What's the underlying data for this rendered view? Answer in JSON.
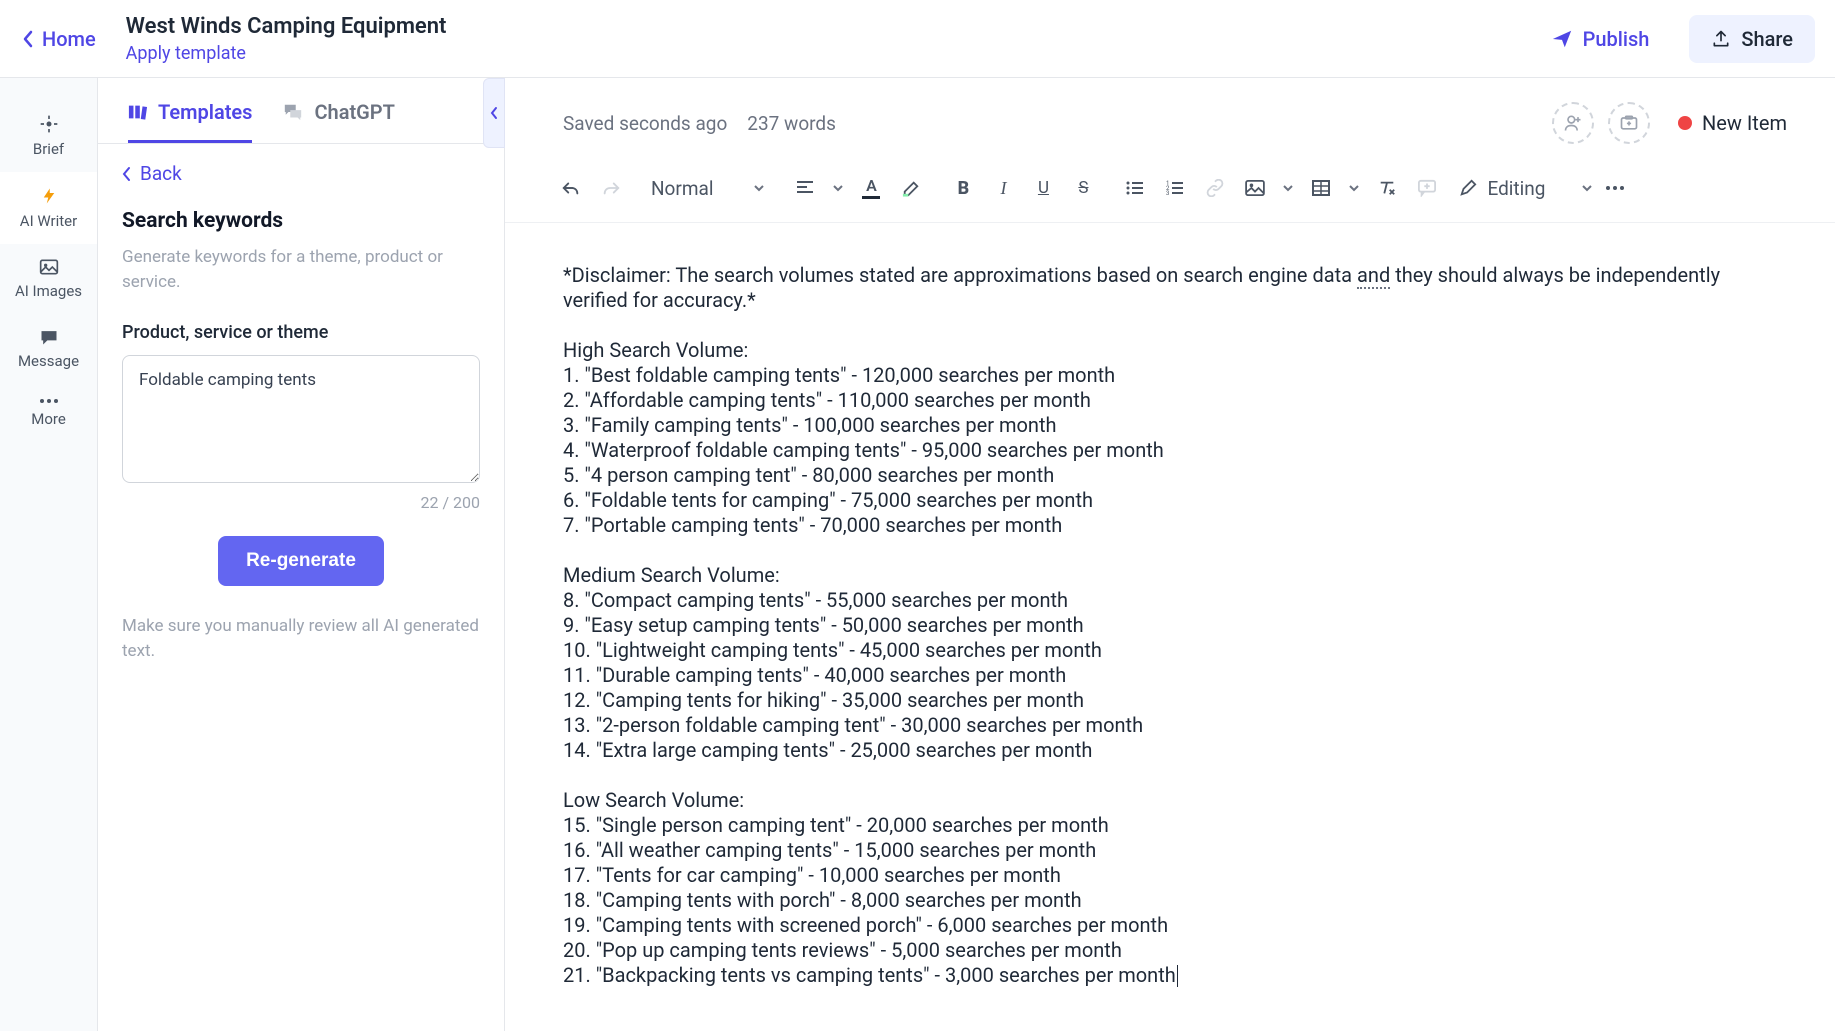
{
  "header": {
    "home": "Home",
    "title": "West Winds Camping Equipment",
    "apply_template": "Apply template",
    "publish": "Publish",
    "share": "Share"
  },
  "rail": {
    "brief": "Brief",
    "ai_writer": "AI Writer",
    "ai_images": "AI Images",
    "message": "Message",
    "more": "More"
  },
  "sidepanel": {
    "tabs": {
      "templates": "Templates",
      "chatgpt": "ChatGPT"
    },
    "back": "Back",
    "heading": "Search keywords",
    "desc": "Generate keywords for a theme, product or service.",
    "field_label": "Product, service or theme",
    "input_value": "Foldable camping tents",
    "char_count": "22 / 200",
    "regen": "Re-generate",
    "review_note": "Make sure you manually review all AI generated text."
  },
  "editor": {
    "saved": "Saved seconds ago",
    "word_count": "237 words",
    "new_item": "New Item",
    "style_select": "Normal",
    "mode_select": "Editing"
  },
  "doc": {
    "disclaimer_pre": "*Disclaimer: The search volumes stated are approximations based on search engine data ",
    "disclaimer_and": "and",
    "disclaimer_post": " they should always be independently verified for accuracy.*",
    "sections": [
      {
        "title": "High Search Volume:",
        "items": [
          "1. \"Best foldable camping tents\" - 120,000 searches per month",
          "2. \"Affordable camping tents\" - 110,000 searches per month",
          "3. \"Family camping tents\" - 100,000 searches per month",
          "4. \"Waterproof foldable camping tents\" - 95,000 searches per month",
          "5. \"4 person camping tent\" - 80,000 searches per month",
          "6. \"Foldable tents for camping\" - 75,000 searches per month",
          "7. \"Portable camping tents\" - 70,000 searches per month"
        ]
      },
      {
        "title": "Medium Search Volume:",
        "items": [
          "8. \"Compact camping tents\" - 55,000 searches per month",
          "9. \"Easy setup camping tents\" - 50,000 searches per month",
          "10. \"Lightweight camping tents\" - 45,000 searches per month",
          "11. \"Durable camping tents\" - 40,000 searches per month",
          "12. \"Camping tents for hiking\" - 35,000 searches per month",
          "13. \"2-person foldable camping tent\" - 30,000 searches per month",
          "14. \"Extra large camping tents\" - 25,000 searches per month"
        ]
      },
      {
        "title": "Low Search Volume:",
        "items": [
          "15. \"Single person camping tent\" - 20,000 searches per month",
          "16. \"All weather camping tents\" - 15,000 searches per month",
          "17. \"Tents for car camping\" - 10,000 searches per month",
          "18. \"Camping tents with porch\" - 8,000 searches per month",
          "19. \"Camping tents with screened porch\" - 6,000 searches per month",
          "20. \"Pop up camping tents reviews\" - 5,000 searches per month",
          "21. \"Backpacking tents vs camping tents\" - 3,000 searches per month"
        ]
      }
    ]
  }
}
